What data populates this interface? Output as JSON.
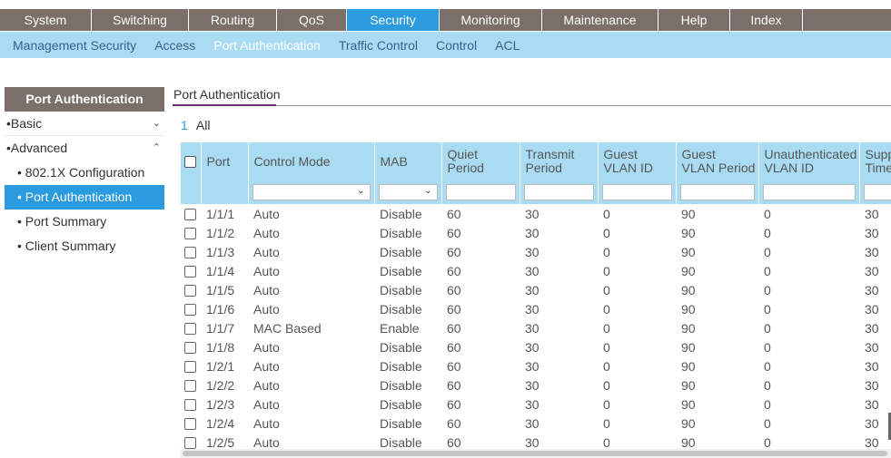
{
  "topnav": {
    "tabs": [
      {
        "label": "System",
        "active": false
      },
      {
        "label": "Switching",
        "active": false
      },
      {
        "label": "Routing",
        "active": false
      },
      {
        "label": "QoS",
        "active": false
      },
      {
        "label": "Security",
        "active": true
      },
      {
        "label": "Monitoring",
        "active": false
      },
      {
        "label": "Maintenance",
        "active": false
      },
      {
        "label": "Help",
        "active": false
      },
      {
        "label": "Index",
        "active": false
      }
    ]
  },
  "subnav": {
    "items": [
      {
        "label": "Management Security",
        "active": false
      },
      {
        "label": "Access",
        "active": false
      },
      {
        "label": "Port Authentication",
        "active": true
      },
      {
        "label": "Traffic Control",
        "active": false
      },
      {
        "label": "Control",
        "active": false
      },
      {
        "label": "ACL",
        "active": false
      }
    ]
  },
  "sidebar": {
    "title": "Port Authentication",
    "basic_label": "Basic",
    "advanced_label": "Advanced",
    "sub_items": [
      {
        "label": "802.1X Configuration",
        "active": false
      },
      {
        "label": "Port Authentication",
        "active": true
      },
      {
        "label": "Port Summary",
        "active": false
      },
      {
        "label": "Client Summary",
        "active": false
      }
    ]
  },
  "content": {
    "title": "Port Authentication",
    "paging": {
      "page": "1",
      "all": "All"
    }
  },
  "table": {
    "headers": [
      {
        "line1": "",
        "line2": ""
      },
      {
        "line1": "Port",
        "line2": ""
      },
      {
        "line1": "Control Mode",
        "line2": ""
      },
      {
        "line1": "MAB",
        "line2": ""
      },
      {
        "line1": "Quiet",
        "line2": "Period"
      },
      {
        "line1": "Transmit",
        "line2": "Period"
      },
      {
        "line1": "Guest",
        "line2": "VLAN ID"
      },
      {
        "line1": "Guest",
        "line2": "VLAN Period"
      },
      {
        "line1": "Unauthenticated",
        "line2": "VLAN ID"
      },
      {
        "line1": "Supp",
        "line2": "Time"
      }
    ],
    "rows": [
      [
        "1/1/1",
        "Auto",
        "Disable",
        "60",
        "30",
        "0",
        "90",
        "0",
        "30"
      ],
      [
        "1/1/2",
        "Auto",
        "Disable",
        "60",
        "30",
        "0",
        "90",
        "0",
        "30"
      ],
      [
        "1/1/3",
        "Auto",
        "Disable",
        "60",
        "30",
        "0",
        "90",
        "0",
        "30"
      ],
      [
        "1/1/4",
        "Auto",
        "Disable",
        "60",
        "30",
        "0",
        "90",
        "0",
        "30"
      ],
      [
        "1/1/5",
        "Auto",
        "Disable",
        "60",
        "30",
        "0",
        "90",
        "0",
        "30"
      ],
      [
        "1/1/6",
        "Auto",
        "Disable",
        "60",
        "30",
        "0",
        "90",
        "0",
        "30"
      ],
      [
        "1/1/7",
        "MAC Based",
        "Enable",
        "60",
        "30",
        "0",
        "90",
        "0",
        "30"
      ],
      [
        "1/1/8",
        "Auto",
        "Disable",
        "60",
        "30",
        "0",
        "90",
        "0",
        "30"
      ],
      [
        "1/2/1",
        "Auto",
        "Disable",
        "60",
        "30",
        "0",
        "90",
        "0",
        "30"
      ],
      [
        "1/2/2",
        "Auto",
        "Disable",
        "60",
        "30",
        "0",
        "90",
        "0",
        "30"
      ],
      [
        "1/2/3",
        "Auto",
        "Disable",
        "60",
        "30",
        "0",
        "90",
        "0",
        "30"
      ],
      [
        "1/2/4",
        "Auto",
        "Disable",
        "60",
        "30",
        "0",
        "90",
        "0",
        "30"
      ],
      [
        "1/2/5",
        "Auto",
        "Disable",
        "60",
        "30",
        "0",
        "90",
        "0",
        "30"
      ]
    ]
  },
  "colors": {
    "nav_bg": "#7a7069",
    "accent": "#2b9be0",
    "subnav_bg": "#a9dcf3",
    "title_underline": "#6a2c7b"
  },
  "icons": {
    "expand": "chevron-down-icon",
    "collapse": "chevron-up-icon",
    "dropdown": "dropdown-arrow-icon",
    "checkbox": "checkbox-icon"
  }
}
